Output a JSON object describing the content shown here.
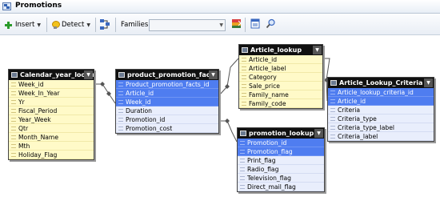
{
  "window": {
    "title": "Promotions"
  },
  "toolbar": {
    "insert_label": "Insert",
    "detect_label": "Detect",
    "families_label": "Families",
    "families_value": ""
  },
  "tables": {
    "calendar": {
      "name": "Calendar_year_lookup",
      "columns": [
        "Week_id",
        "Week_In_Year",
        "Yr",
        "Fiscal_Period",
        "Year_Week",
        "Qtr",
        "Month_Name",
        "Mth",
        "Holiday_Flag"
      ]
    },
    "facts": {
      "name": "product_promotion_facts",
      "columns": [
        "Product_promotion_facts_id",
        "Article_id",
        "Week_id",
        "Duration",
        "Promotion_id",
        "Promotion_cost"
      ]
    },
    "article": {
      "name": "Article_lookup",
      "columns": [
        "Article_id",
        "Article_label",
        "Category",
        "Sale_price",
        "Family_name",
        "Family_code"
      ]
    },
    "promotion": {
      "name": "promotion_lookup",
      "columns": [
        "Promotion_id",
        "Promotion_flag",
        "Print_flag",
        "Radio_flag",
        "Television_flag",
        "Direct_mail_flag"
      ]
    },
    "criteria": {
      "name": "Article_Lookup_Criteria",
      "columns": [
        "Article_lookup_criteria_id",
        "Article_id",
        "Criteria",
        "Criteria_type",
        "Criteria_type_label",
        "Criteria_label"
      ]
    }
  },
  "colors": {
    "header": "#101010",
    "yellow_row": "#fffac8",
    "blue_row": "#4f7df0",
    "link": "#555555"
  }
}
